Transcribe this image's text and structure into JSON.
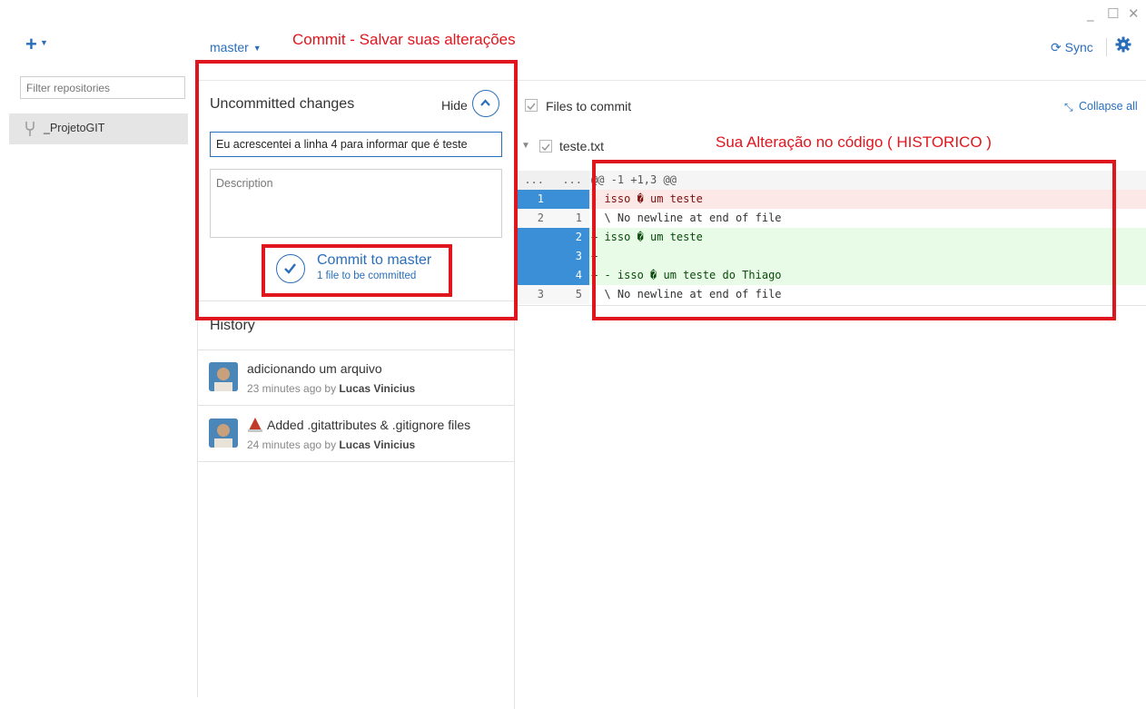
{
  "window": {
    "minimize_glyph": "_",
    "maximize_glyph": "☐",
    "close_glyph": "✕"
  },
  "sidebar": {
    "add_glyph": "+",
    "filter_placeholder": "Filter repositories",
    "repos": [
      {
        "name": "_ProjetoGIT",
        "icon": "repo-fork-icon"
      }
    ]
  },
  "header": {
    "branch": "master",
    "sync_label": "Sync",
    "annotation": "Commit - Salvar suas alterações"
  },
  "uncommitted": {
    "title": "Uncommitted changes",
    "hide_label": "Hide",
    "summary_value": "Eu acrescentei a linha 4 para informar que é teste",
    "description_placeholder": "Description",
    "commit_label": "Commit to master",
    "commit_sub": "1 file to be committed"
  },
  "history": {
    "title": "History",
    "items": [
      {
        "message": "adicionando um arquivo",
        "time": "23 minutes ago by",
        "author": "Lucas Vinicius"
      },
      {
        "message": "Added .gitattributes & .gitignore files",
        "time": "24 minutes ago by",
        "author": "Lucas Vinicius"
      }
    ]
  },
  "changes": {
    "files_to_commit": "Files to commit",
    "collapse_all": "Collapse all",
    "file_name": "teste.txt",
    "annotation": "Sua Alteração no código  ( HISTORICO )",
    "diff": [
      {
        "old": "...",
        "new": "...",
        "code": "@@ -1 +1,3 @@",
        "kind": "hunk"
      },
      {
        "old": "1",
        "new": "",
        "code": "- isso � um teste",
        "kind": "del"
      },
      {
        "old": "2",
        "new": "1",
        "code": "  \\ No newline at end of file",
        "kind": "ctx"
      },
      {
        "old": "",
        "new": "2",
        "code": "+ isso � um teste",
        "kind": "add"
      },
      {
        "old": "",
        "new": "3",
        "code": "+",
        "kind": "add"
      },
      {
        "old": "",
        "new": "4",
        "code": "+ - isso � um teste do Thiago",
        "kind": "add"
      },
      {
        "old": "3",
        "new": "5",
        "code": "  \\ No newline at end of file",
        "kind": "ctx"
      }
    ]
  },
  "colors": {
    "accent": "#2a6ebb",
    "annotation_red": "#e0161e",
    "del_bg": "#fde8e8",
    "add_bg": "#e7fbe6",
    "gutter_selected": "#3b8fd6"
  }
}
